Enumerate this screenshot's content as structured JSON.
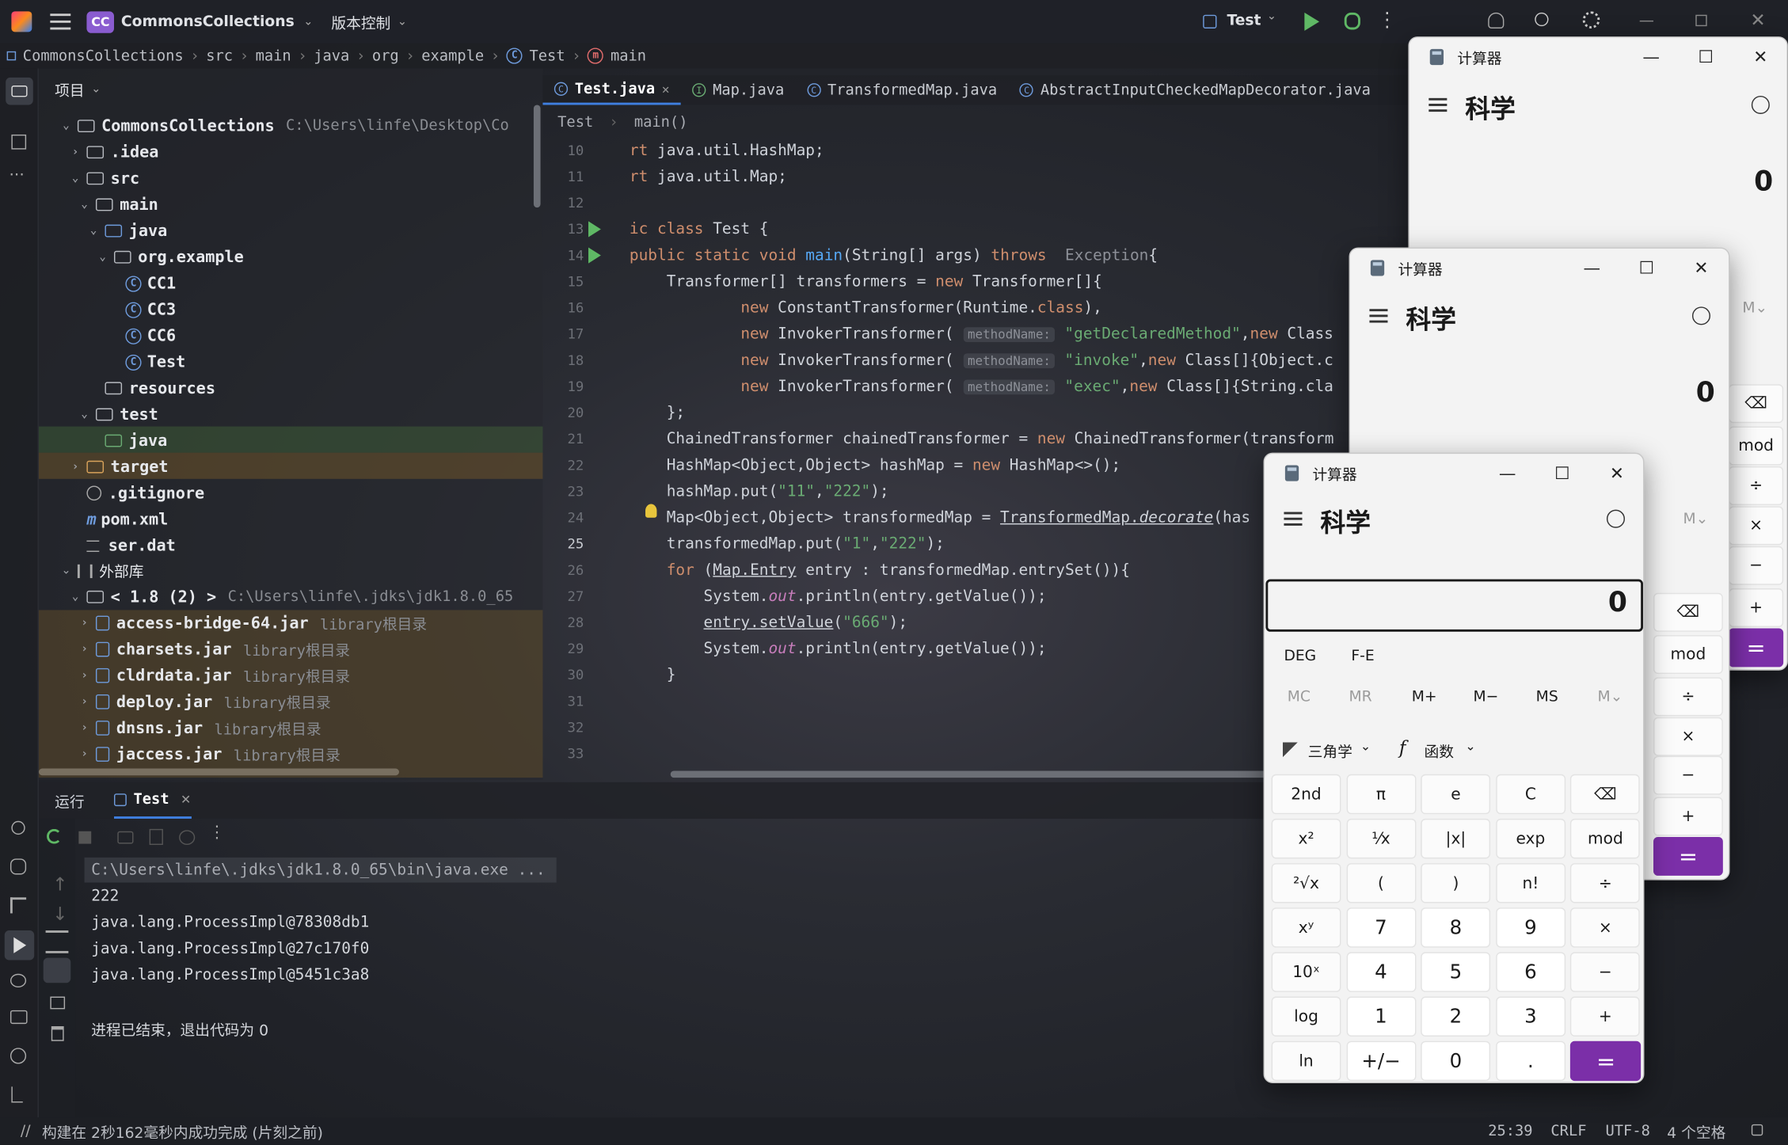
{
  "titlebar": {
    "project_badge": "CC",
    "project_name": "CommonsCollections",
    "vcs_label": "版本控制",
    "run_config": "Test"
  },
  "breadcrumb": [
    "CommonsCollections",
    "src",
    "main",
    "java",
    "org",
    "example",
    "Test",
    "main"
  ],
  "project_panel": {
    "title": "项目",
    "root_path": "C:\\Users\\linfe\\Desktop\\Co",
    "external_libs": "外部库",
    "jdk_label": "< 1.8 (2) >",
    "jdk_path": "C:\\Users\\linfe\\.jdks\\jdk1.8.0_65",
    "library_suffix": "library",
    "root_dir_suffix": "根目录",
    "tree": [
      {
        "label": "CommonsCollections"
      },
      {
        "label": ".idea"
      },
      {
        "label": "src"
      },
      {
        "label": "main"
      },
      {
        "label": "java"
      },
      {
        "label": "org.example"
      },
      {
        "label": "CC1"
      },
      {
        "label": "CC3"
      },
      {
        "label": "CC6"
      },
      {
        "label": "Test"
      },
      {
        "label": "resources"
      },
      {
        "label": "test"
      },
      {
        "label": "java"
      },
      {
        "label": "target"
      },
      {
        "label": ".gitignore"
      },
      {
        "label": "pom.xml"
      },
      {
        "label": "ser.dat"
      }
    ],
    "jars": [
      "access-bridge-64.jar",
      "charsets.jar",
      "cldrdata.jar",
      "deploy.jar",
      "dnsns.jar",
      "jaccess.jar"
    ]
  },
  "editor": {
    "tabs": [
      "Test.java",
      "Map.java",
      "TransformedMap.java",
      "AbstractInputCheckedMapDecorator.java"
    ],
    "crumb_class": "Test",
    "crumb_method": "main()",
    "line_numbers": [
      "10",
      "11",
      "12",
      "13",
      "14",
      "15",
      "16",
      "17",
      "18",
      "19",
      "20",
      "21",
      "22",
      "23",
      "24",
      "25",
      "26",
      "27",
      "28",
      "29",
      "30",
      "31",
      "32",
      "33"
    ],
    "param_hint": "methodName:"
  },
  "run_panel": {
    "label": "运行",
    "tab": "Test",
    "output": [
      "C:\\Users\\linfe\\.jdks\\jdk1.8.0_65\\bin\\java.exe ...",
      "222",
      "java.lang.ProcessImpl@78308db1",
      "java.lang.ProcessImpl@27c170f0",
      "java.lang.ProcessImpl@5451c3a8",
      "",
      "进程已结束，退出代码为 0"
    ]
  },
  "statusbar": {
    "message": "构建在 2秒162毫秒内成功完成 (片刻之前)",
    "position": "25:39",
    "line_sep": "CRLF",
    "encoding": "UTF-8",
    "indent": "4 个空格"
  },
  "calculator": {
    "app_title": "计算器",
    "mode": "科学",
    "display": "0",
    "angle": "DEG",
    "fe": "F-E",
    "memory": [
      "MC",
      "MR",
      "M+",
      "M−",
      "MS",
      "M⌄"
    ],
    "trig_label": "三角学",
    "func_label": "函数",
    "keys": [
      [
        "2nd",
        "π",
        "e",
        "C",
        "⌫"
      ],
      [
        "x²",
        "¹⁄x",
        "|x|",
        "exp",
        "mod"
      ],
      [
        "²√x",
        "(",
        ")",
        "n!",
        "÷"
      ],
      [
        "xʸ",
        "7",
        "8",
        "9",
        "×"
      ],
      [
        "10ˣ",
        "4",
        "5",
        "6",
        "−"
      ],
      [
        "log",
        "1",
        "2",
        "3",
        "+"
      ],
      [
        "ln",
        "+/−",
        "0",
        ".",
        "="
      ]
    ],
    "partial_mod": "mod",
    "accent_color": "#7b2fa8"
  },
  "colors": {
    "keyword": "#cf8e6d",
    "string": "#6aab73",
    "method": "#56a8f5",
    "accent": "#3f7fe0"
  }
}
